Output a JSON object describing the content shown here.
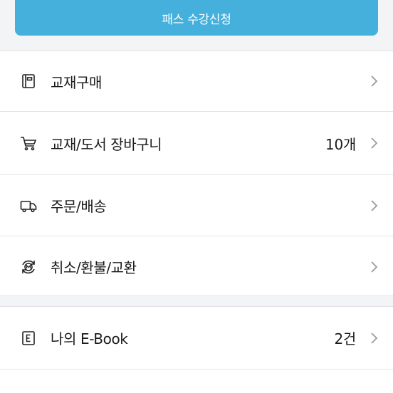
{
  "pass_button": {
    "label": "패스 수강신청"
  },
  "menu": {
    "items": [
      {
        "label": "교재구매",
        "value": ""
      },
      {
        "label": "교재/도서 장바구니",
        "value": "10개"
      },
      {
        "label": "주문/배송",
        "value": ""
      },
      {
        "label": "취소/환불/교환",
        "value": ""
      }
    ]
  },
  "ebook": {
    "label": "나의 E-Book",
    "value": "2건"
  },
  "colors": {
    "accent": "#45b0dc",
    "divider": "#e1e3e6",
    "background": "#f3f4f6"
  }
}
